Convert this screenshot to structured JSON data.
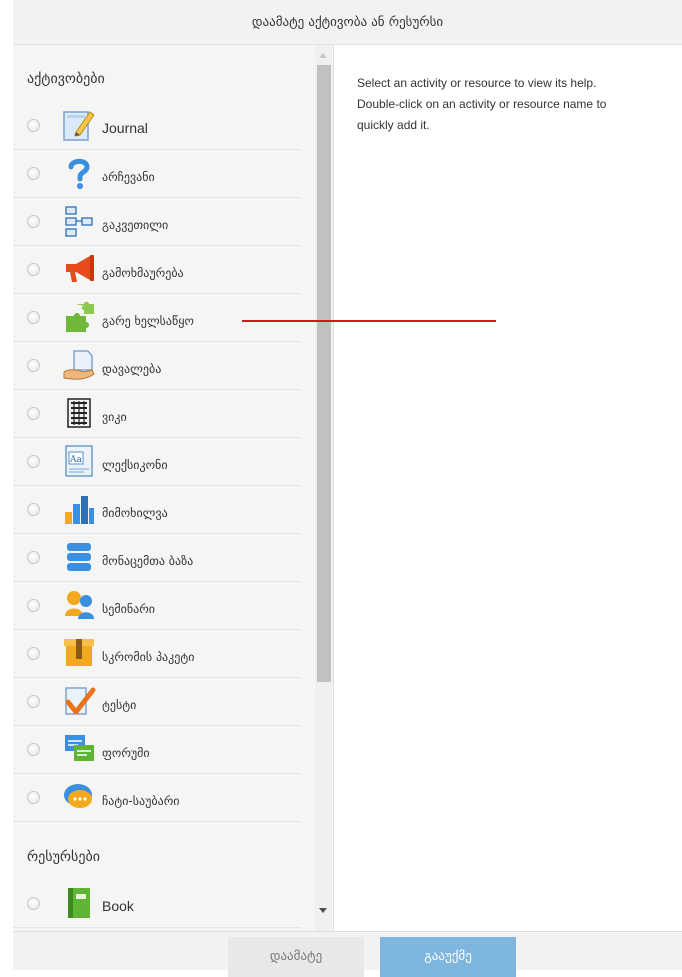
{
  "dialog": {
    "title": "დაამატე აქტივობა ან რესურსი",
    "help_lines": [
      "Select an activity or resource to view its help.",
      "Double-click on an activity or resource name to",
      "quickly add it."
    ],
    "buttons": {
      "add": "დაამატე",
      "cancel": "გააუქმე"
    }
  },
  "activities": {
    "title": "აქტივობები",
    "items": [
      {
        "label": "Journal",
        "icon": "journal-icon"
      },
      {
        "label": "არჩევანი",
        "icon": "choice-question-icon"
      },
      {
        "label": "გაკვეთილი",
        "icon": "lesson-icon"
      },
      {
        "label": "გამოხმაურება",
        "icon": "feedback-megaphone-icon"
      },
      {
        "label": "გარე ხელსაწყო",
        "icon": "external-tool-puzzle-icon"
      },
      {
        "label": "დავალება",
        "icon": "assignment-icon"
      },
      {
        "label": "ვიკი",
        "icon": "wiki-icon"
      },
      {
        "label": "ლექსიკონი",
        "icon": "glossary-icon"
      },
      {
        "label": "მიმოხილვა",
        "icon": "survey-chart-icon"
      },
      {
        "label": "მონაცემთა ბაზა",
        "icon": "database-icon"
      },
      {
        "label": "სემინარი",
        "icon": "workshop-icon"
      },
      {
        "label": "სკრომის პაკეტი",
        "icon": "scorm-package-icon"
      },
      {
        "label": "ტესტი",
        "icon": "quiz-checkmark-icon"
      },
      {
        "label": "ფორუმი",
        "icon": "forum-icon"
      },
      {
        "label": "ჩატი-საუბარი",
        "icon": "chat-icon"
      }
    ]
  },
  "resources": {
    "title": "რესურსები",
    "items": [
      {
        "label": "Book",
        "icon": "book-icon"
      }
    ]
  }
}
